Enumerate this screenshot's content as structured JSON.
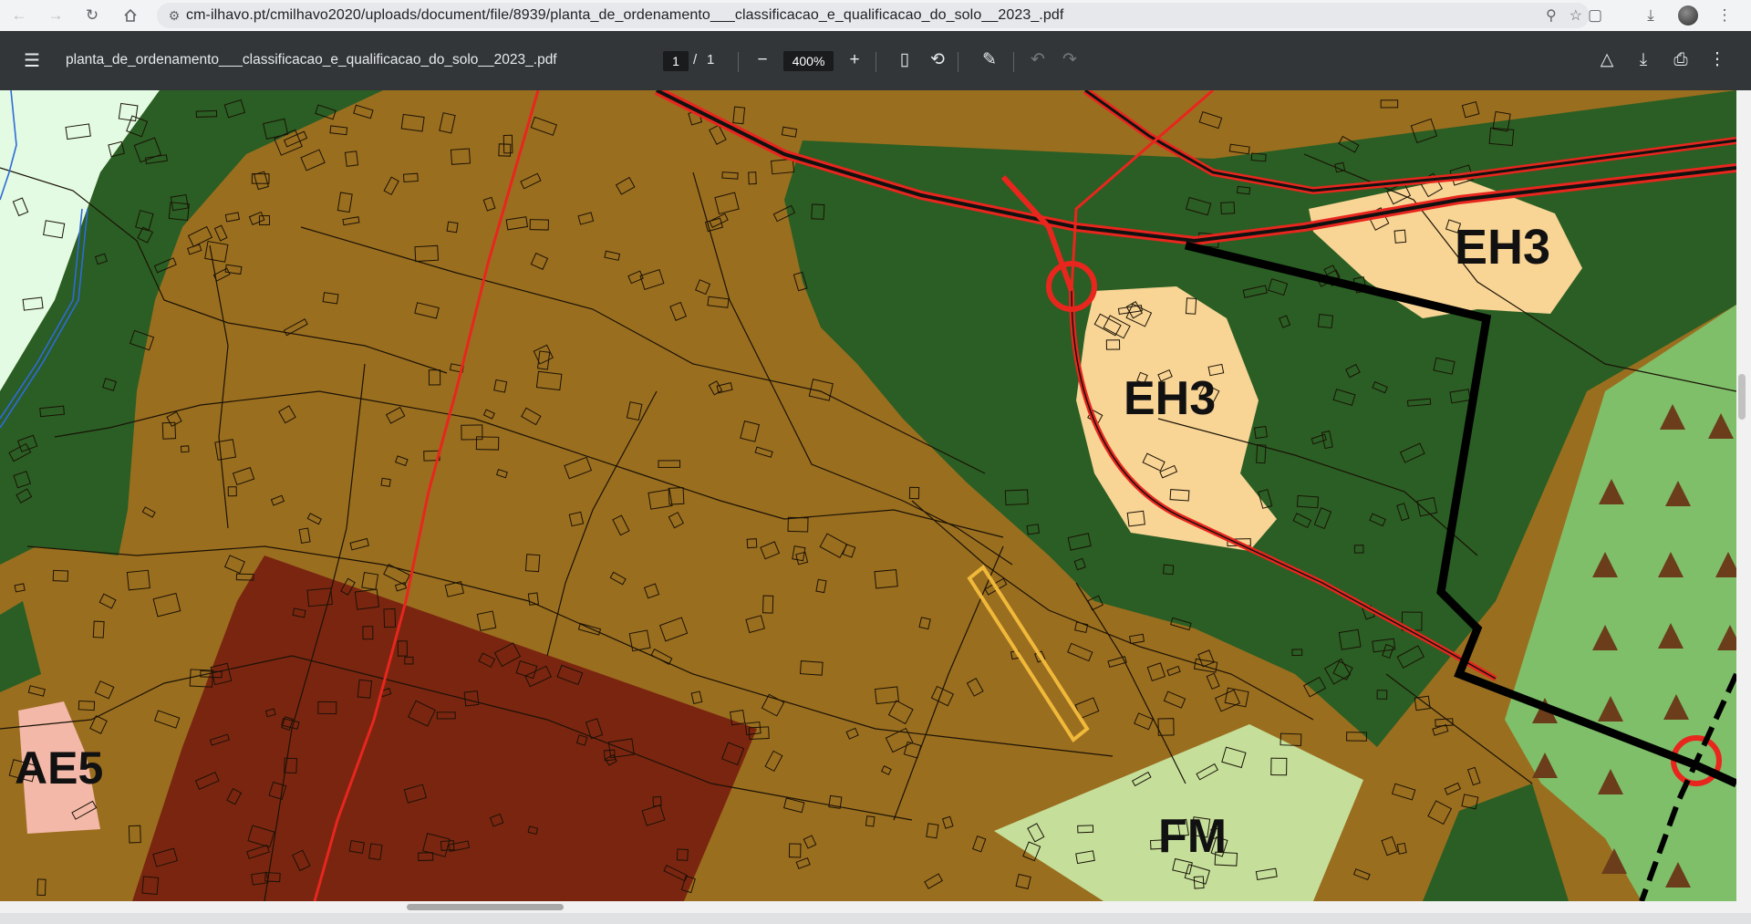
{
  "browser": {
    "url": "cm-ilhavo.pt/cmilhavo2020/uploads/document/file/8939/planta_de_ordenamento___classificacao_e_qualificacao_do_solo__2023_.pdf"
  },
  "pdf_toolbar": {
    "title": "planta_de_ordenamento___classificacao_e_qualificacao_do_solo__2023_.pdf",
    "page_current": "1",
    "page_separator": "/",
    "page_total": "1",
    "zoom": "400%"
  },
  "map": {
    "labels": {
      "eh3_top": "EH3",
      "eh3_center": "EH3",
      "ae5": "AE5",
      "fm": "FM"
    },
    "colors": {
      "urban_brown": "#9a6e1f",
      "dark_red_zone": "#7a2510",
      "forest_green": "#2a5e24",
      "light_green": "#c5df9b",
      "triangle_green": "#7fbf6a",
      "pale_mint": "#e2fbe2",
      "eh3_beige": "#f8d495",
      "ae5_pink": "#f3b8a8",
      "road_red": "#e8261e",
      "highlight_yellow": "#f0b93a"
    }
  }
}
